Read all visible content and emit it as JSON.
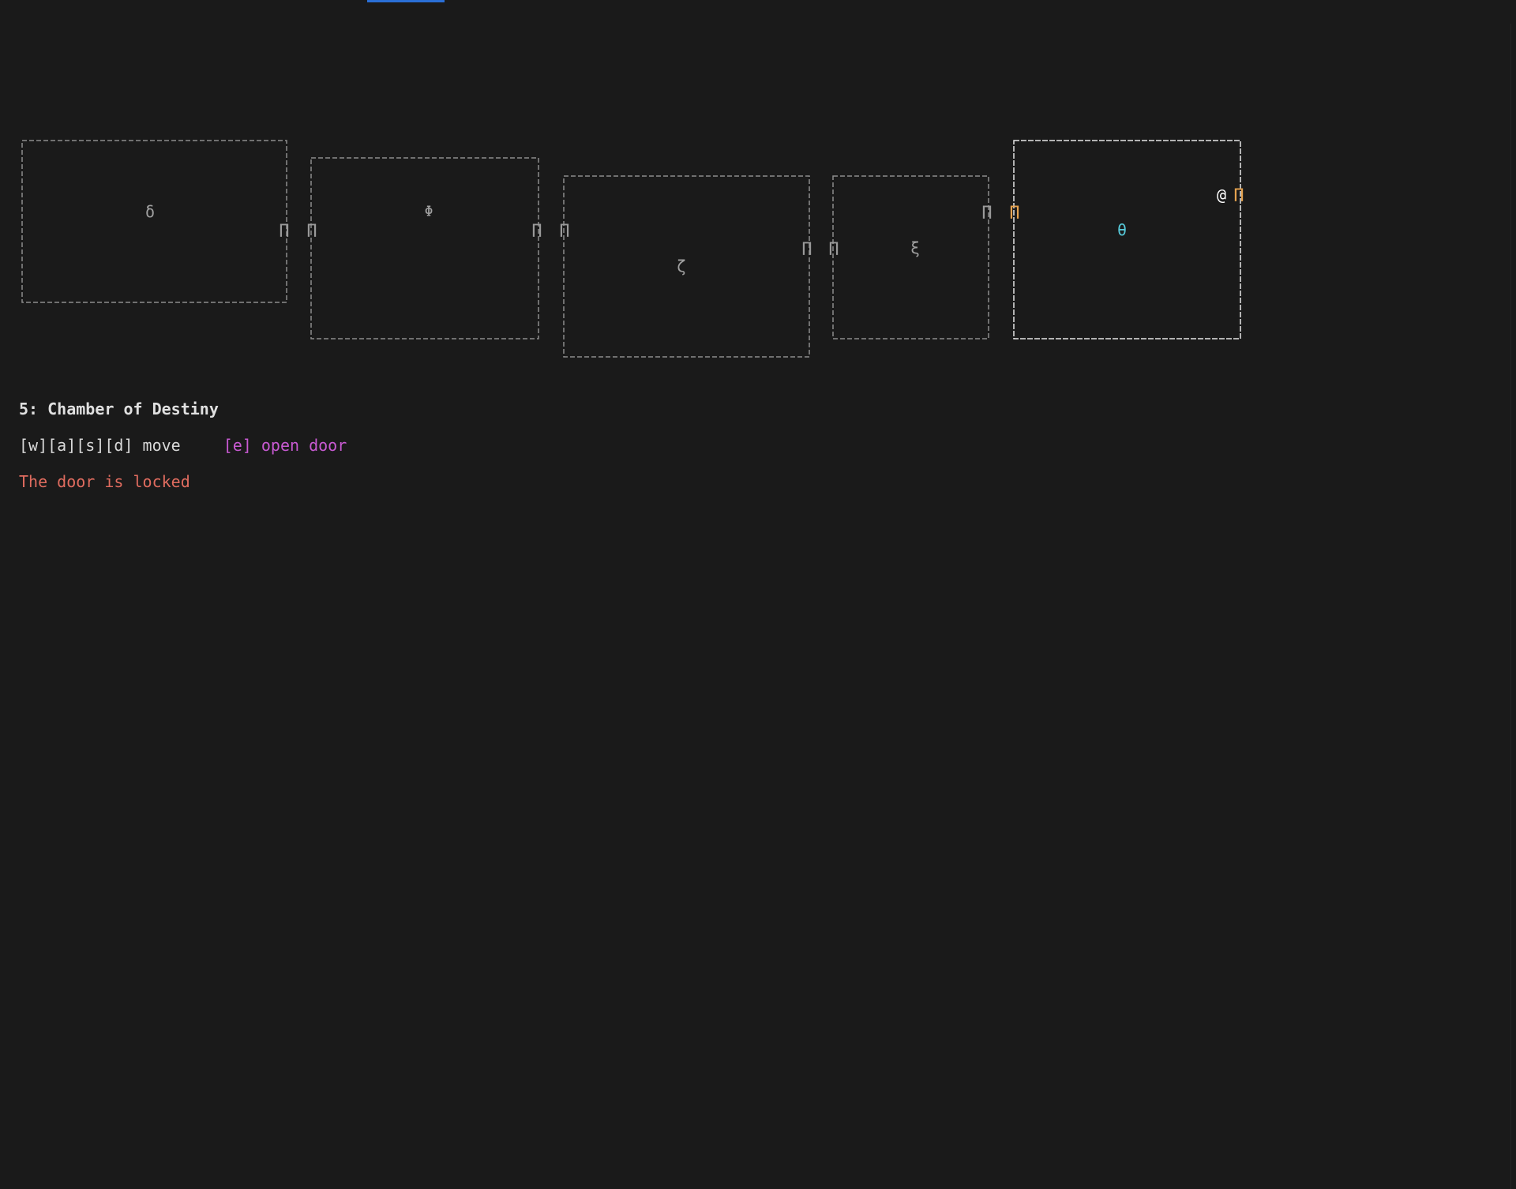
{
  "game": {
    "current_room_title": "5: Chamber of Destiny",
    "controls": {
      "move_label": "[w][a][s][d] move",
      "action_label": "[e] open door"
    },
    "message": "The door is locked",
    "player_glyph": "@",
    "door_glyph": "Π",
    "colors": {
      "background": "#1a1a1a",
      "wall_dim": "#8c8c8c",
      "wall_active": "#e6e6e6",
      "door_dim": "#9a9a9a",
      "door_active": "#e5a24f",
      "item": "#56c8d8",
      "player": "#ffffff",
      "action_text": "#c85ad2",
      "message_text": "#e06c5f",
      "accent": "#2a6fd6"
    },
    "rooms": [
      {
        "id": 1,
        "glyph": "δ",
        "active": false
      },
      {
        "id": 2,
        "glyph": "Φ",
        "active": false
      },
      {
        "id": 3,
        "glyph": "ζ",
        "active": false
      },
      {
        "id": 4,
        "glyph": "ξ",
        "active": false
      },
      {
        "id": 5,
        "glyph": "θ",
        "active": true
      }
    ]
  }
}
